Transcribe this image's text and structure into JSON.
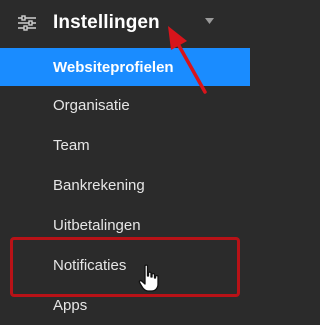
{
  "header": {
    "title": "Instellingen",
    "icon": "settings-sliders-icon",
    "caret_icon": "caret-down-icon"
  },
  "items": [
    {
      "label": "Websiteprofielen",
      "active": true
    },
    {
      "label": "Organisatie"
    },
    {
      "label": "Team"
    },
    {
      "label": "Bankrekening"
    },
    {
      "label": "Uitbetalingen"
    },
    {
      "label": "Notificaties"
    },
    {
      "label": "Apps"
    }
  ],
  "colors": {
    "background": "#2b2b2b",
    "active": "#1a8cff",
    "annotation": "#d8141b",
    "text": "#e6e6e6"
  },
  "annotations": {
    "arrow_icon": "red-arrow-icon",
    "cursor_icon": "hand-pointer-icon"
  }
}
